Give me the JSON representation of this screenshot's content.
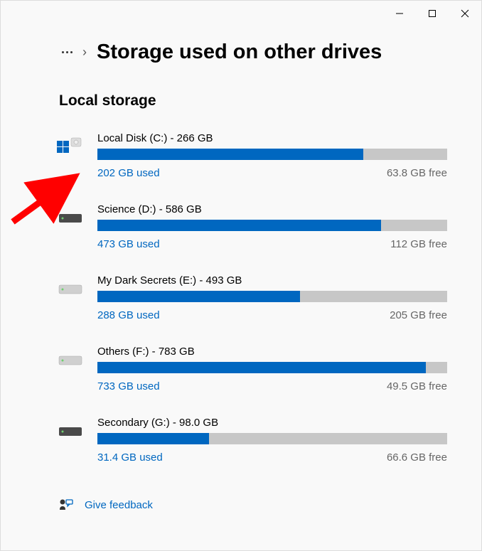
{
  "header": {
    "page_title": "Storage used on other drives"
  },
  "section": {
    "title": "Local storage"
  },
  "drives": [
    {
      "label": "Local Disk (C:) - 266 GB",
      "used": "202 GB used",
      "free": "63.8 GB free",
      "percent": 76,
      "icon": "windows"
    },
    {
      "label": "Science (D:) - 586 GB",
      "used": "473 GB used",
      "free": "112 GB free",
      "percent": 81,
      "icon": "hdd"
    },
    {
      "label": "My Dark Secrets (E:) - 493 GB",
      "used": "288 GB used",
      "free": "205 GB free",
      "percent": 58,
      "icon": "hdd-light"
    },
    {
      "label": "Others (F:) - 783 GB",
      "used": "733 GB used",
      "free": "49.5 GB free",
      "percent": 94,
      "icon": "hdd-light"
    },
    {
      "label": "Secondary (G:) - 98.0 GB",
      "used": "31.4 GB used",
      "free": "66.6 GB free",
      "percent": 32,
      "icon": "hdd"
    }
  ],
  "feedback": {
    "label": "Give feedback"
  },
  "colors": {
    "accent": "#0067c0",
    "bar_bg": "#c7c7c7"
  }
}
